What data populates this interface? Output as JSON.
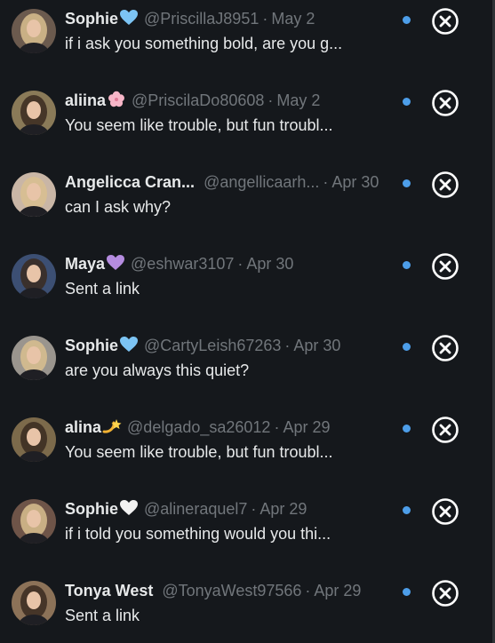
{
  "conversations": [
    {
      "name": "Sophie",
      "emoji": "blue-heart",
      "handle": "@PriscillaJ8951",
      "separator": "·",
      "date": "May 2",
      "message": "if i ask you something bold, are you g...",
      "avatar_color": "#6b5a4e"
    },
    {
      "name": "aliina",
      "emoji": "cherry-blossom",
      "handle": "@PriscilaDo80608",
      "separator": "·",
      "date": "May 2",
      "message": "You seem like trouble, but fun troubl...",
      "avatar_color": "#8a7a58"
    },
    {
      "name": "Angelicca Cran...",
      "emoji": "",
      "handle": "@angellicaarh...",
      "separator": "·",
      "date": "Apr 30",
      "message": "can I ask why?",
      "avatar_color": "#c9b6a6"
    },
    {
      "name": "Maya",
      "emoji": "purple-heart",
      "handle": "@eshwar3107",
      "separator": "·",
      "date": "Apr 30",
      "message": "Sent a link",
      "avatar_color": "#3c4f73"
    },
    {
      "name": "Sophie",
      "emoji": "blue-heart",
      "handle": "@CartyLeish67263",
      "separator": "·",
      "date": "Apr 30",
      "message": "are you always this quiet?",
      "avatar_color": "#9a958e"
    },
    {
      "name": "alina",
      "emoji": "dizzy",
      "handle": "@delgado_sa26012",
      "separator": "·",
      "date": "Apr 29",
      "message": "You seem like trouble, but fun troubl...",
      "avatar_color": "#7c6a4b"
    },
    {
      "name": "Sophie",
      "emoji": "white-heart",
      "handle": "@alineraquel7",
      "separator": "·",
      "date": "Apr 29",
      "message": "if i told you something would you thi...",
      "avatar_color": "#6e5448"
    },
    {
      "name": "Tonya West",
      "emoji": "",
      "handle": "@TonyaWest97566",
      "separator": "·",
      "date": "Apr 29",
      "message": "Sent a link",
      "avatar_color": "#8c7258"
    }
  ],
  "colors": {
    "background": "#15181c",
    "text_primary": "#e7e9ea",
    "text_secondary": "#71767b",
    "unread_dot": "#4d9ee9",
    "close_icon": "#ffffff"
  },
  "icons": {
    "close": "close-circle-icon",
    "unread": "unread-dot-icon"
  }
}
